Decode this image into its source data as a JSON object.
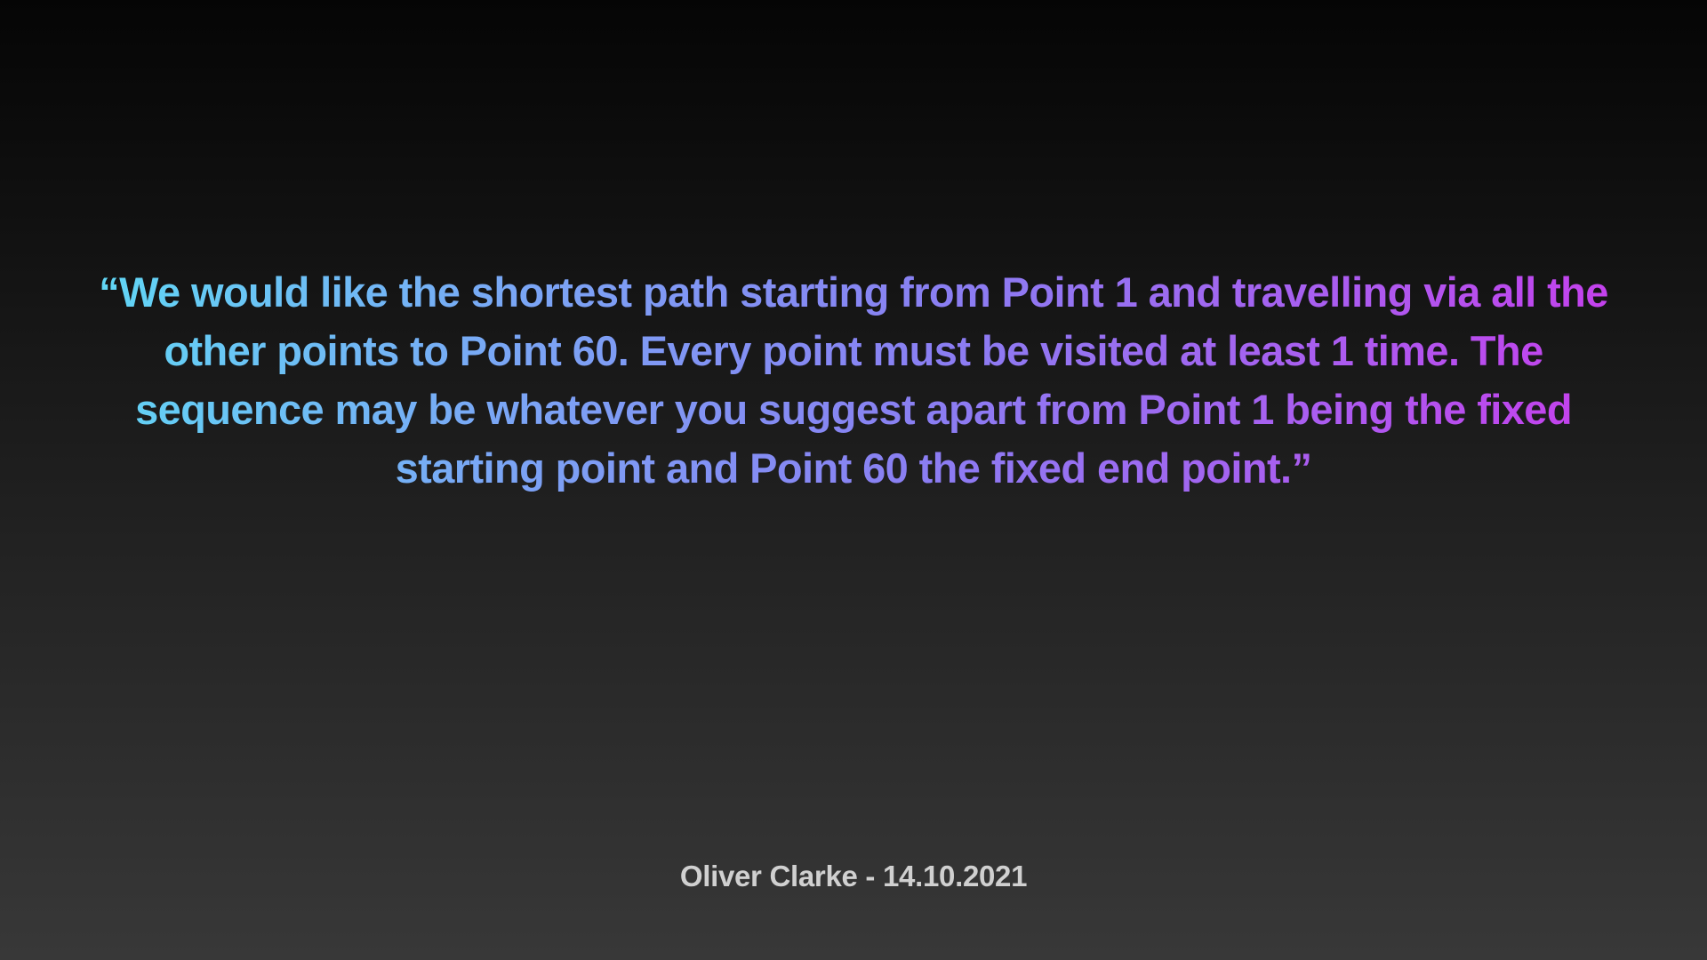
{
  "quote": {
    "text": "“We would like the shortest path starting from Point 1 and travelling via all the other points to Point 60. Every point must be visited at least 1 time. The sequence may be whatever you suggest apart from Point 1 being the fixed starting point and Point 60 the fixed end point.”",
    "gradient_colors": [
      "#5fd9f5",
      "#7aa6f5",
      "#8a7ef2",
      "#a85ff0",
      "#c93cec"
    ]
  },
  "attribution": {
    "text": "Oliver Clarke - 14.10.2021",
    "color": "#d0d0d0"
  },
  "background": {
    "top_color": "#050505",
    "bottom_color": "#383838"
  }
}
